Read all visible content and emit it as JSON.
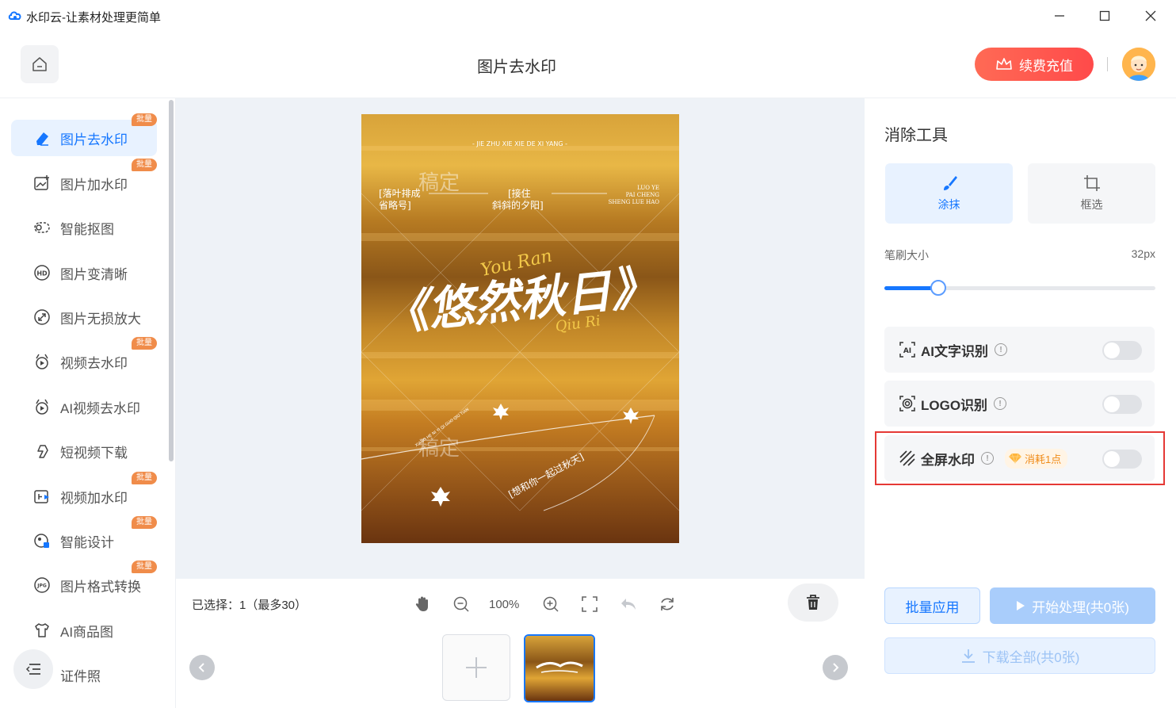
{
  "window": {
    "title": "水印云-让素材处理更简单"
  },
  "header": {
    "page_title": "图片去水印",
    "vip_label": "续费充值"
  },
  "sidebar": {
    "items": [
      {
        "label": "图片去水印",
        "badge": "批量",
        "active": true,
        "icon": "eraser-icon"
      },
      {
        "label": "图片加水印",
        "badge": "批量",
        "icon": "image-add-icon"
      },
      {
        "label": "智能抠图",
        "badge": "",
        "icon": "cutout-icon"
      },
      {
        "label": "图片变清晰",
        "badge": "",
        "icon": "hd-icon"
      },
      {
        "label": "图片无损放大",
        "badge": "",
        "icon": "enlarge-icon"
      },
      {
        "label": "视频去水印",
        "badge": "批量",
        "icon": "video-eraser-icon"
      },
      {
        "label": "AI视频去水印",
        "badge": "",
        "icon": "ai-video-eraser-icon"
      },
      {
        "label": "短视频下载",
        "badge": "",
        "icon": "link-download-icon"
      },
      {
        "label": "视频加水印",
        "badge": "批量",
        "icon": "video-add-icon"
      },
      {
        "label": "智能设计",
        "badge": "批量",
        "icon": "design-icon"
      },
      {
        "label": "图片格式转换",
        "badge": "批量",
        "icon": "jpg-icon"
      },
      {
        "label": "AI商品图",
        "badge": "",
        "icon": "shirt-icon"
      },
      {
        "label": "证件照",
        "badge": "",
        "icon": "id-photo-icon"
      }
    ]
  },
  "poster": {
    "top_line": "- JIE ZHU XIE XIE DE XI YANG -",
    "wm1": "稿定",
    "left_note": "[落叶排成\n省略号]",
    "mid_note": "[接住\n斜斜的夕阳]",
    "right_note": "LUO YE\nPAI CHENG\nSHENG LUE HAO",
    "script_top": "You Ran",
    "title_main": "《悠然秋日》",
    "script_bottom": "Qiu Ri",
    "wm2": "稿定",
    "arc_text": "[想和你一起过秋天]",
    "small_arc": "XIANG HE NI YI QI GUO QIU TIAN"
  },
  "canvas_toolbar": {
    "selected_text": "已选择：1（最多30）",
    "zoom": "100%"
  },
  "right_panel": {
    "title": "消除工具",
    "tools": [
      {
        "label": "涂抹",
        "active": true
      },
      {
        "label": "框选",
        "active": false
      }
    ],
    "brush_label": "笔刷大小",
    "brush_value": "32px",
    "brush_fraction": 0.2,
    "options": [
      {
        "label": "AI文字识别",
        "on": false
      },
      {
        "label": "LOGO识别",
        "on": false
      },
      {
        "label": "全屏水印",
        "on": false,
        "cost": "消耗1点"
      }
    ],
    "batch_label": "批量应用",
    "start_label": "开始处理(共0张)",
    "download_label": "下载全部(共0张)"
  },
  "colors": {
    "accent": "#1677ff",
    "vip": "#ff5a4e",
    "badge": "#f08c4a",
    "highlight": "#e53935"
  }
}
